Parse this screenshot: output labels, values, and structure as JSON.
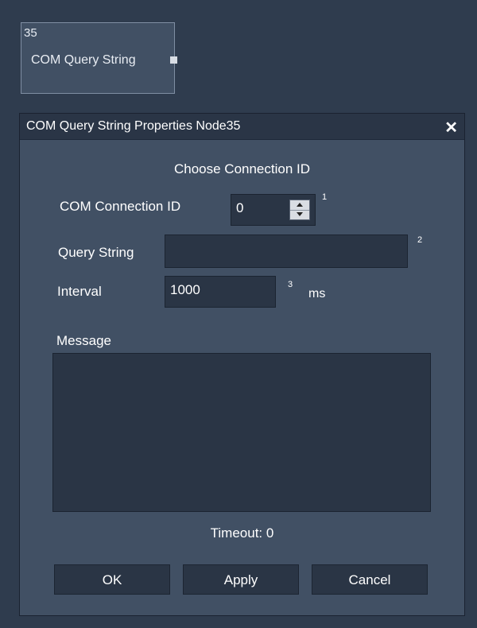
{
  "node": {
    "id": "35",
    "label": "COM Query String"
  },
  "dialog": {
    "title": "COM Query String Properties Node35",
    "close_glyph": "✕",
    "heading": "Choose Connection ID",
    "connection": {
      "label": "COM Connection ID",
      "value": "0",
      "marker": "1"
    },
    "query": {
      "label": "Query String",
      "value": "",
      "marker": "2"
    },
    "interval": {
      "label": "Interval",
      "value": "1000",
      "marker": "3",
      "unit": "ms"
    },
    "message": {
      "label": "Message",
      "value": ""
    },
    "timeout": "Timeout:  0",
    "buttons": {
      "ok": "OK",
      "apply": "Apply",
      "cancel": "Cancel"
    }
  },
  "colors": {
    "background": "#2f3c4e",
    "panel": "#415064",
    "field": "#2a3545",
    "titlebar": "#2a3546"
  }
}
